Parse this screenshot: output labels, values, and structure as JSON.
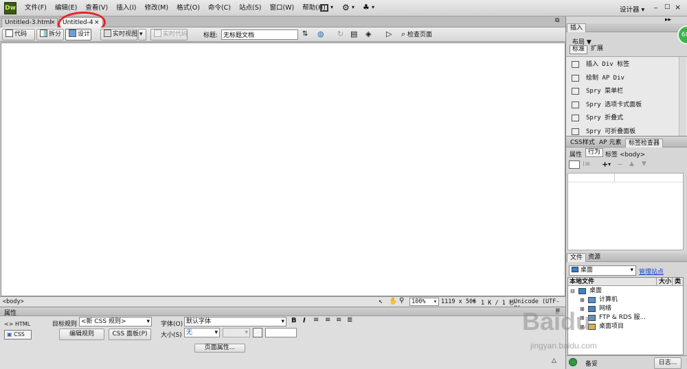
{
  "app": {
    "logo": "Dw",
    "menus": [
      "文件(F)",
      "编辑(E)",
      "查看(V)",
      "插入(I)",
      "修改(M)",
      "格式(O)",
      "命令(C)",
      "站点(S)",
      "窗口(W)",
      "帮助(H)"
    ],
    "workspace": "设计器",
    "window_controls": [
      "_",
      "□",
      "×"
    ]
  },
  "doc_tabs": [
    {
      "label": "Untitled-3.html",
      "close": "×"
    },
    {
      "label": "Untitled-4",
      "close": "×"
    }
  ],
  "toolbar": {
    "code": "代码",
    "split": "拆分",
    "design": "设计",
    "live_view": "实时视图",
    "live_code": "实时代码",
    "title_label": "标题:",
    "title_value": "无标题文档",
    "inspect": "检查页面"
  },
  "status_bar": {
    "tag": "<body>",
    "zoom": "100%",
    "size": "1119 x 506",
    "weight": "1 K / 1 秒",
    "encoding": "Unicode (UTF-8)"
  },
  "properties": {
    "title": "属性",
    "html_btn": "HTML",
    "css_btn": "CSS",
    "target_rule_label": "目标规则",
    "target_rule_value": "<新 CSS 规则>",
    "edit_rule": "编辑规则",
    "css_panel": "CSS 面板(P)",
    "font_label": "字体(O)",
    "font_value": "默认字体",
    "size_label": "大小(S)",
    "size_value": "无",
    "page_props": "页面属性..."
  },
  "insert_panel": {
    "tab": "插入",
    "category": "布局",
    "sub_tabs": [
      "标准",
      "扩展"
    ],
    "items": [
      "插入 Div 标签",
      "绘制 AP Div",
      "Spry 菜单栏",
      "Spry 选项卡式面板",
      "Spry 折叠式",
      "Spry 可折叠面板"
    ]
  },
  "css_panel": {
    "tabs": [
      "CSS样式",
      "AP 元素",
      "标签检查器"
    ],
    "sub_tabs": [
      "属性",
      "行为"
    ],
    "tag_label": "标签 <body>"
  },
  "files_panel": {
    "tabs": [
      "文件",
      "资源"
    ],
    "site_value": "桌面",
    "manage": "管理站点",
    "columns": [
      "本地文件",
      "大小",
      "类"
    ],
    "tree": [
      "桌面",
      "计算机",
      "网络",
      "FTP & RDS 服...",
      "桌面项目"
    ],
    "log": "日志...",
    "ready": "备妥"
  },
  "badge": "68",
  "watermark": {
    "main": "Baidu",
    "sub": "jingyan.baidu.com"
  }
}
